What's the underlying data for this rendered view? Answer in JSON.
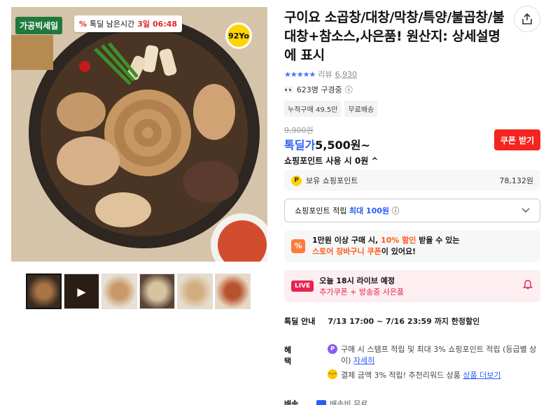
{
  "gallery": {
    "brand_badge": "가공빅세일",
    "deal_prefix": "%",
    "deal_label": "톡딜 남은시간",
    "deal_days": "3일",
    "deal_time": "06:48",
    "seller_logo": "92Yo",
    "thumbnail_video_icon": "play-icon"
  },
  "product": {
    "title": "구이요 소곱창/대창/막창/특양/불곱창/불대창+참소스,사은품! 원산지: 상세설명에 표시",
    "stars": "★★★★★",
    "review_label": "리뷰",
    "review_count": "6,930",
    "viewing_text": "623명 구경중",
    "chips": [
      "누적구매 49.5만",
      "무료배송"
    ]
  },
  "price": {
    "original": "9,900원",
    "sale_label": "톡딜가",
    "sale_price": "5,500원~",
    "coupon_button": "쿠폰 받기",
    "point_use": "쇼핑포인트 사용 시 0원 ^"
  },
  "points": {
    "icon_letter": "P",
    "label": "보유 쇼핑포인트",
    "amount": "78,132원",
    "accum_label": "쇼핑포인트 적립",
    "accum_max": "최대 100원",
    "info_icon": "ⓘ"
  },
  "cart_coupon": {
    "icon": "%",
    "line1_a": "1만원 이상 구매 시, ",
    "line1_b": "10% 할인",
    "line1_c": " 받을 수 있는",
    "line2_a": "스토어 장바구니 쿠폰",
    "line2_b": "이 있어요!"
  },
  "live": {
    "badge": "LIVE",
    "line1": "오늘 18시 라이브 예정",
    "line2": "추가쿠폰 + 방송중 사은품"
  },
  "deal_info": {
    "label": "톡딜 안내",
    "value": "7/13 17:00 ~ 7/16 23:59 까지 한정할인"
  },
  "benefit": {
    "label": "혜택",
    "row1_icon": "P",
    "row1_text": "구매 시 스탬프 적립 및 최대 3% 쇼핑포인트 적립 (등급별 상이)",
    "row1_link": "자세히",
    "row2_icon": "ᵔᵕᵔ",
    "row2_text": "결제 금액 3% 적립! 추천리워드 상품",
    "row2_link": "상품 더보기"
  },
  "shipping": {
    "label": "배송",
    "value": "배송비 무료"
  },
  "colors": {
    "accent_blue": "#2b5cf6",
    "coupon_red": "#f4251e",
    "live_pink": "#e8224f",
    "orange": "#ff5a1f"
  }
}
